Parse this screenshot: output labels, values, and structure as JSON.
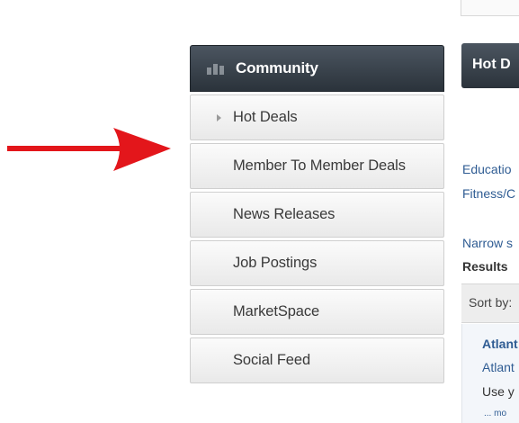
{
  "sidebar": {
    "header": {
      "label": "Community",
      "icon": "community-icon"
    },
    "items": [
      {
        "label": "Hot Deals",
        "has_caret": true
      },
      {
        "label": "Member To Member Deals"
      },
      {
        "label": "News Releases"
      },
      {
        "label": "Job Postings"
      },
      {
        "label": "MarketSpace"
      },
      {
        "label": "Social Feed"
      }
    ]
  },
  "annotation": {
    "icon": "red-arrow-icon",
    "color": "#e3161b"
  },
  "content": {
    "header_button": "Hot D",
    "category_links": [
      "Educatio",
      "Fitness/C"
    ],
    "narrow_text": "Narrow s",
    "results_label": "Results",
    "sort_label": "Sort by:",
    "result": {
      "title": "Atlant",
      "subtitle": "Atlant",
      "description": "Use y",
      "more": "... mo"
    }
  },
  "colors": {
    "header_dark": "#2b333b",
    "link_blue": "#2f5c93",
    "arrow_red": "#e3161b"
  }
}
